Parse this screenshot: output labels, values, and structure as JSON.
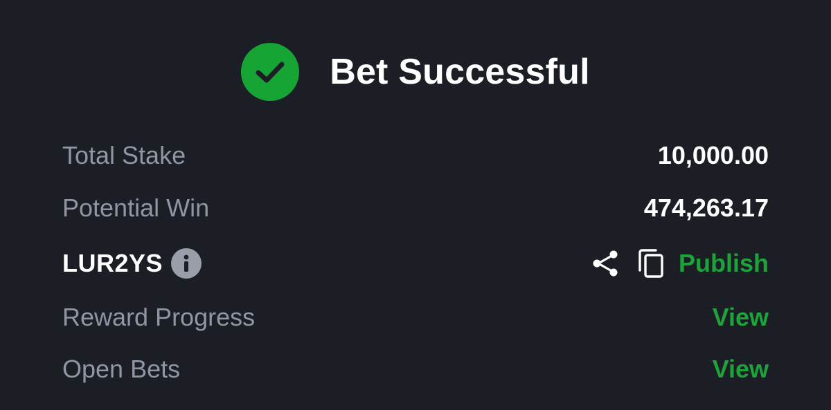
{
  "header": {
    "title": "Bet Successful",
    "status_icon": "check-circle-icon",
    "status_color": "#16a535"
  },
  "summary": {
    "total_stake_label": "Total Stake",
    "total_stake_value": "10,000.00",
    "potential_win_label": "Potential Win",
    "potential_win_value": "474,263.17"
  },
  "booking": {
    "code": "LUR2YS",
    "info_icon": "info-icon",
    "share_icon": "share-icon",
    "copy_icon": "copy-icon",
    "publish_label": "Publish"
  },
  "links": {
    "reward_progress_label": "Reward Progress",
    "reward_progress_action": "View",
    "open_bets_label": "Open Bets",
    "open_bets_action": "View"
  },
  "colors": {
    "background": "#1c1e25",
    "accent_green": "#1ea33a",
    "muted_text": "#9096a3",
    "primary_text": "#ffffff"
  }
}
